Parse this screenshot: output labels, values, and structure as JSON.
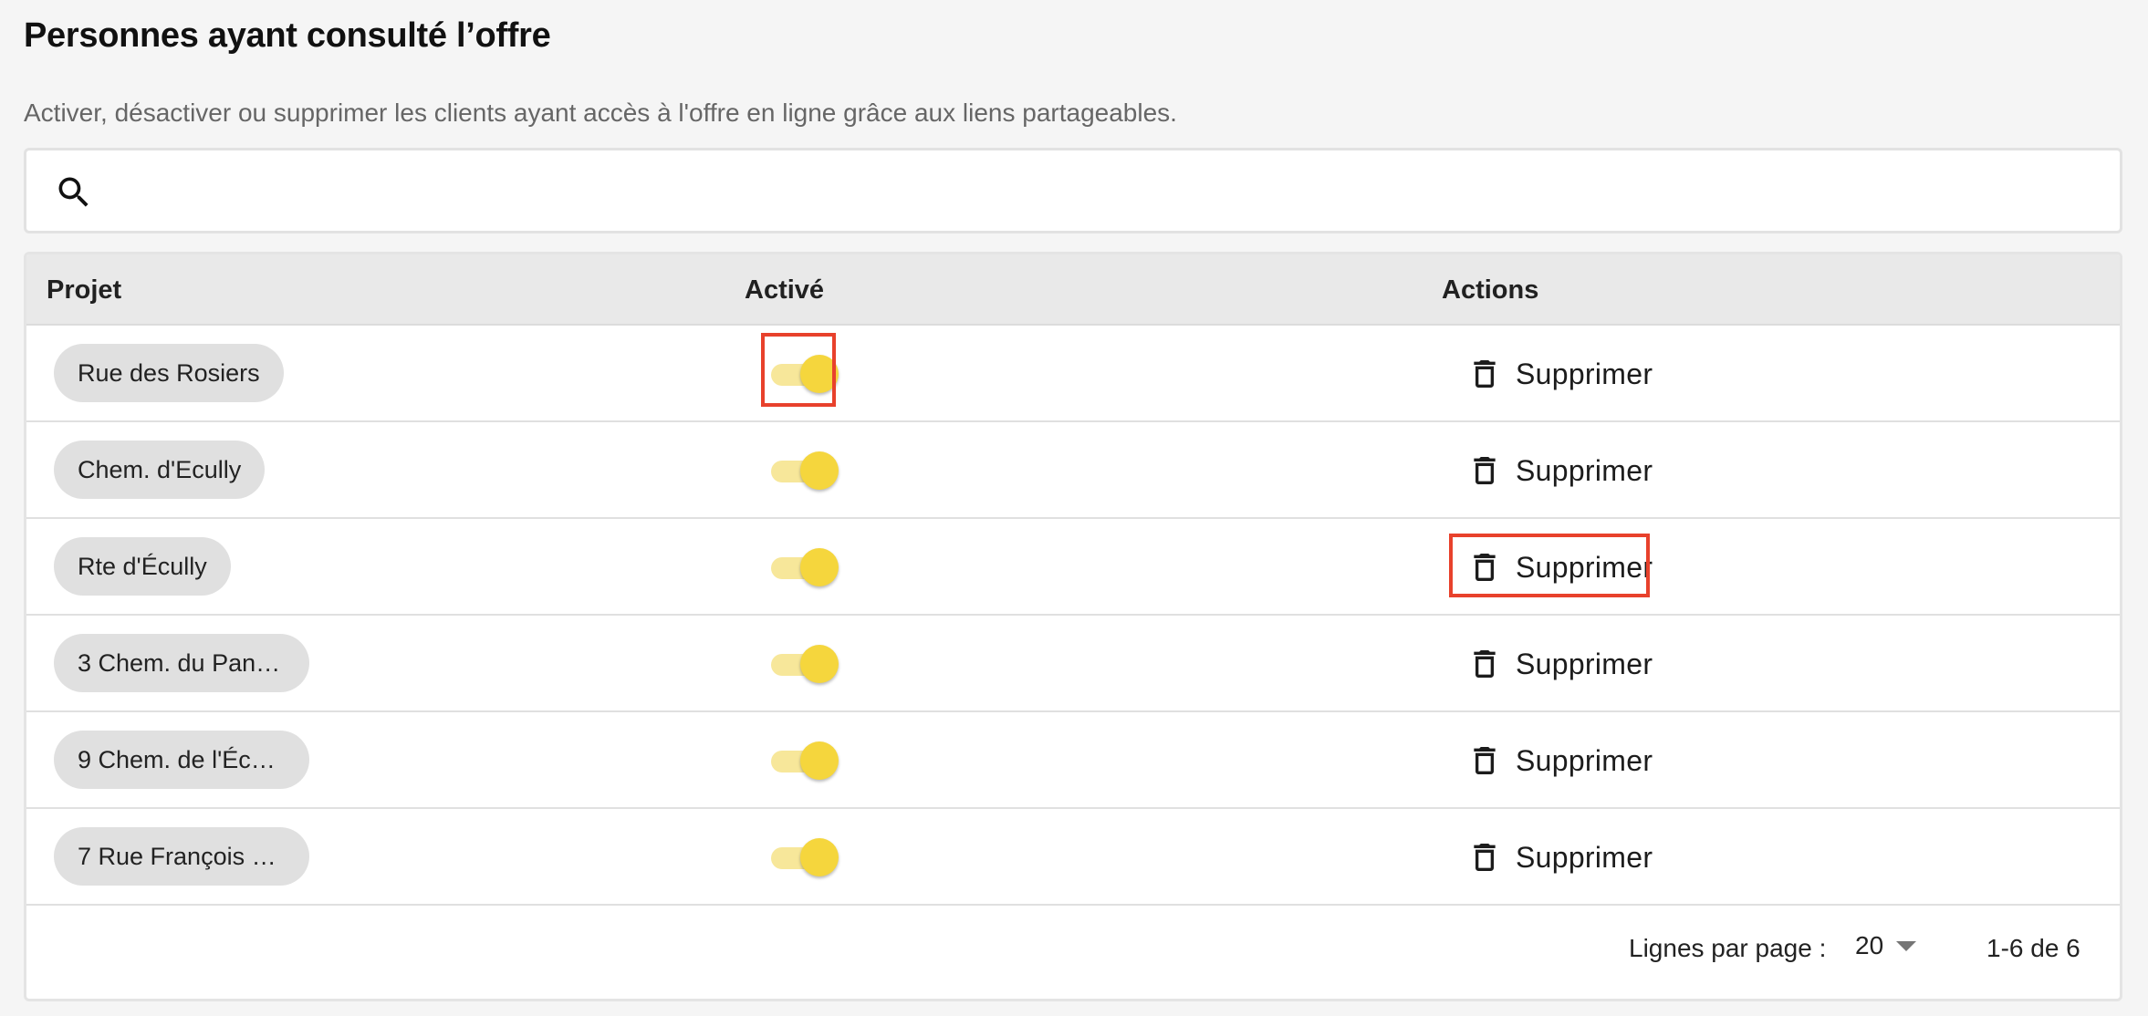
{
  "page": {
    "title": "Personnes ayant consulté l’offre",
    "subtitle": "Activer, désactiver ou supprimer les clients ayant accès à l'offre en ligne grâce aux liens partageables."
  },
  "search": {
    "icon": "search-icon",
    "placeholder": ""
  },
  "table": {
    "columns": [
      "Projet",
      "Activé",
      "Actions"
    ],
    "rows": [
      {
        "project": "Rue des Rosiers",
        "active": true,
        "action": "Supprimer"
      },
      {
        "project": "Chem. d'Ecully",
        "active": true,
        "action": "Supprimer"
      },
      {
        "project": "Rte d'Écully",
        "active": true,
        "action": "Supprimer"
      },
      {
        "project": "3 Chem. du Panor…",
        "active": true,
        "action": "Supprimer"
      },
      {
        "project": "9 Chem. de l'Écur…",
        "active": true,
        "action": "Supprimer"
      },
      {
        "project": "7 Rue François Vi…",
        "active": true,
        "action": "Supprimer"
      }
    ]
  },
  "pagination": {
    "rows_per_page_label": "Lignes par page :",
    "rows_per_page_value": "20",
    "range": "1-6 de 6"
  },
  "colors": {
    "toggle_thumb": "#f5d63d",
    "toggle_track": "#f7e79a",
    "highlight": "#e8412c"
  }
}
